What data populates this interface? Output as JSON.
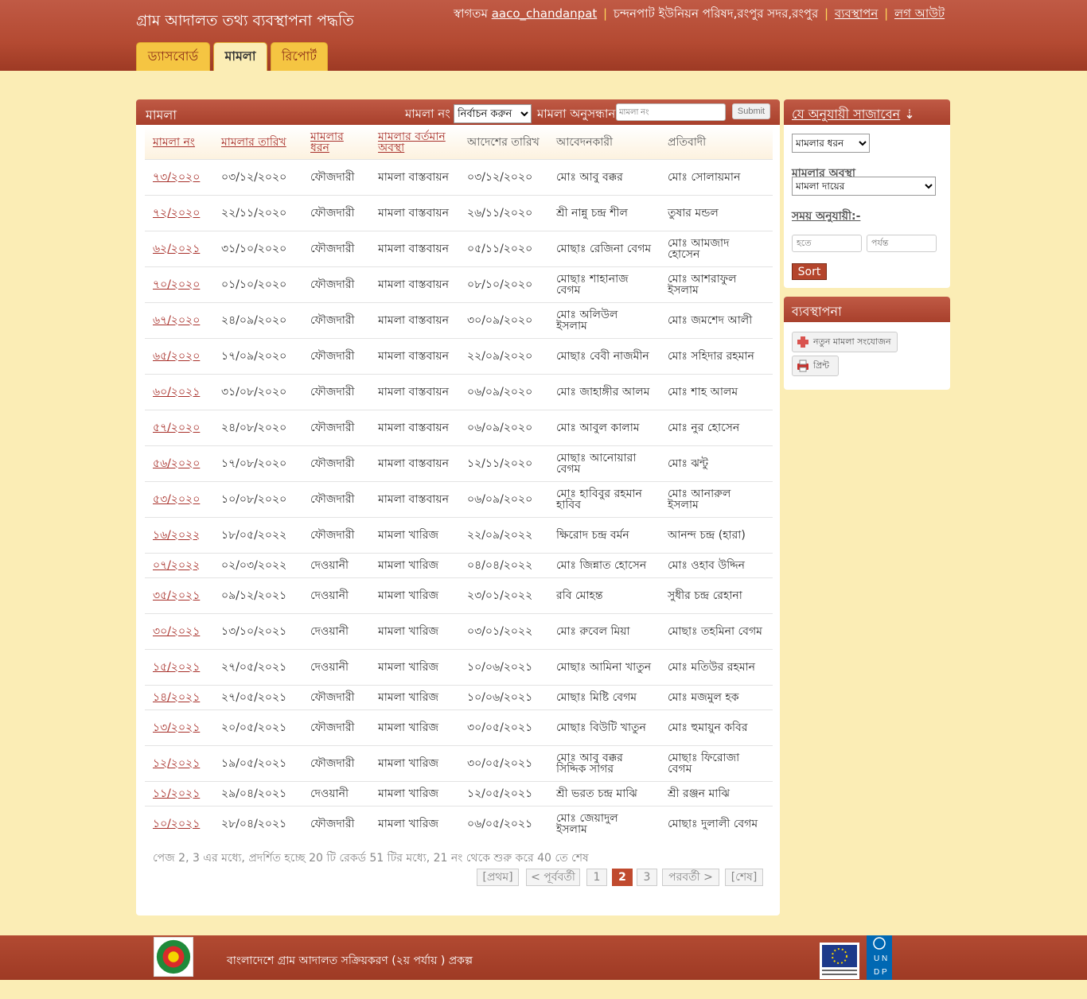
{
  "header": {
    "site_title": "গ্রাম আদালত তথ্য ব্যবস্থাপনা পদ্ধতি",
    "welcome": "স্বাগতম",
    "username": "aaco_chandanpat",
    "union": "চন্দনপাট ইউনিয়ন পরিষদ,রংপুর সদর,রংপুর",
    "manage_link": "ব্যবস্থাপন",
    "logout_link": "লগ আউট",
    "separator": "|"
  },
  "tabs": [
    {
      "label": "ড্যাসবোর্ড"
    },
    {
      "label": "মামলা"
    },
    {
      "label": "রিপোর্ট"
    }
  ],
  "main": {
    "title": "মামলা",
    "case_no_label": "মামলা নং",
    "case_no_select": "নির্বাচন করুন",
    "search_label": "মামলা অনুসন্ধান",
    "search_placeholder": "মামলা নং",
    "submit": "Submit",
    "columns": [
      "মামলা নং",
      "মামলার তারিখ",
      "মামলার ধরন",
      "মামলার বর্তমান অবস্থা",
      "আদেশের তারিখ",
      "আবেদনকারী",
      "প্রতিবাদী"
    ],
    "rows": [
      [
        "৭৩/২০২০",
        "০৩/১২/২০২০",
        "ফৌজদারী",
        "মামলা বাস্তবায়ন",
        "০৩/১২/২০২০",
        "মোঃ আবু বক্কর",
        "মোঃ সোলায়মান"
      ],
      [
        "৭২/২০২০",
        "২২/১১/২০২০",
        "ফৌজদারী",
        "মামলা বাস্তবায়ন",
        "২৬/১১/২০২০",
        "শ্রী নান্নু চন্দ্র শীল",
        "তুষার মন্ডল"
      ],
      [
        "৬২/২০২১",
        "৩১/১০/২০২০",
        "ফৌজদারী",
        "মামলা বাস্তবায়ন",
        "০৫/১১/২০২০",
        "মোছাঃ রেজিনা বেগম",
        "মোঃ আমজাদ হোসেন"
      ],
      [
        "৭০/২০২০",
        "০১/১০/২০২০",
        "ফৌজদারী",
        "মামলা বাস্তবায়ন",
        "০৮/১০/২০২০",
        "মোছাঃ শাহানাজ বেগম",
        "মোঃ আশরাফুল ইসলাম"
      ],
      [
        "৬৭/২০২০",
        "২৪/০৯/২০২০",
        "ফৌজদারী",
        "মামলা বাস্তবায়ন",
        "৩০/০৯/২০২০",
        "মোঃ অলিউল ইসলাম",
        "মোঃ জমশেদ আলী"
      ],
      [
        "৬৫/২০২০",
        "১৭/০৯/২০২০",
        "ফৌজদারী",
        "মামলা বাস্তবায়ন",
        "২২/০৯/২০২০",
        "মোছাঃ বেবী নাজমীন",
        "মোঃ সহিদার রহমান"
      ],
      [
        "৬০/২০২১",
        "৩১/০৮/২০২০",
        "ফৌজদারী",
        "মামলা বাস্তবায়ন",
        "০৬/০৯/২০২০",
        "মোঃ জাহাঙ্গীর আলম",
        "মোঃ শাহ আলম"
      ],
      [
        "৫৭/২০২০",
        "২৪/০৮/২০২০",
        "ফৌজদারী",
        "মামলা বাস্তবায়ন",
        "০৬/০৯/২০২০",
        "মোঃ আবুল কালাম",
        "মোঃ নুর হোসেন"
      ],
      [
        "৫৬/২০২০",
        "১৭/০৮/২০২০",
        "ফৌজদারী",
        "মামলা বাস্তবায়ন",
        "১২/১১/২০২০",
        "মোছাঃ আনোয়ারা বেগম",
        "মোঃ ঝন্টু"
      ],
      [
        "৫৩/২০২০",
        "১০/০৮/২০২০",
        "ফৌজদারী",
        "মামলা বাস্তবায়ন",
        "০৬/০৯/২০২০",
        "মোঃ হাবিবুর রহমান হাবিব",
        "মোঃ আনারুল ইসলাম"
      ],
      [
        "১৬/২০২২",
        "১৮/০৫/২০২২",
        "ফৌজদারী",
        "মামলা খারিজ",
        "২২/০৯/২০২২",
        "ক্ষিরোদ চন্দ্র বর্মন",
        "আনন্দ চন্দ্র (হারা)"
      ],
      [
        "০৭/২০২২",
        "০২/০৩/২০২২",
        "দেওয়ানী",
        "মামলা খারিজ",
        "০৪/০৪/২০২২",
        "মোঃ জিন্নাত হোসেন",
        "মোঃ ওহাব উদ্দিন"
      ],
      [
        "৩৫/২০২১",
        "০৯/১২/২০২১",
        "দেওয়ানী",
        "মামলা খারিজ",
        "২৩/০১/২০২২",
        "রবি মোহন্ত",
        "সুধীর চন্দ্র রেহানা"
      ],
      [
        "৩০/২০২১",
        "১৩/১০/২০২১",
        "দেওয়ানী",
        "মামলা খারিজ",
        "০৩/০১/২০২২",
        "মোঃ রুবেল মিয়া",
        "মোছাঃ তহমিনা বেগম"
      ],
      [
        "১৫/২০২১",
        "২৭/০৫/২০২১",
        "দেওয়ানী",
        "মামলা খারিজ",
        "১০/০৬/২০২১",
        "মোছাঃ আমিনা খাতুন",
        "মোঃ মতিউর রহমান"
      ],
      [
        "১৪/২০২১",
        "২৭/০৫/২০২১",
        "ফৌজদারী",
        "মামলা খারিজ",
        "১০/০৬/২০২১",
        "মোছাঃ মিষ্টি বেগম",
        "মোঃ মজমুল হক"
      ],
      [
        "১৩/২০২১",
        "২০/০৫/২০২১",
        "ফৌজদারী",
        "মামলা খারিজ",
        "৩০/০৫/২০২১",
        "মোছাঃ বিউটি খাতুন",
        "মোঃ হুমায়ুন কবির"
      ],
      [
        "১২/২০২১",
        "১৯/০৫/২০২১",
        "ফৌজদারী",
        "মামলা খারিজ",
        "৩০/০৫/২০২১",
        "মোঃ আবু বক্কর সিদ্দিক সাগর",
        "মোছাঃ ফিরোজা বেগম"
      ],
      [
        "১১/২০২১",
        "২৯/০৪/২০২১",
        "দেওয়ানী",
        "মামলা খারিজ",
        "১২/০৫/২০২১",
        "শ্রী ভরত চন্দ্র মাঝি",
        "শ্রী রঞ্জন মাঝি"
      ],
      [
        "১০/২০২১",
        "২৮/০৪/২০২১",
        "ফৌজদারী",
        "মামলা খারিজ",
        "০৬/০৫/২০২১",
        "মোঃ জেয়াদুল ইসলাম",
        "মোছাঃ দুলালী বেগম"
      ]
    ],
    "summary": "পেজ 2, 3 এর মধ্যে, প্রদর্শিত হচ্ছে 20 টি রেকর্ড 51 টির মধ্যে, 21 নং থেকে শুরু করে 40 তে শেষ",
    "pager": {
      "first": "[প্রথম]",
      "prev": "< পূর্ববর্তী",
      "p1": "1",
      "p2": "2",
      "p3": "3",
      "next": "পরবর্তী >",
      "last": "[শেষ]"
    }
  },
  "sidebar": {
    "sort_title": "যে অনুযায়ী সাজাবেন",
    "sort_arrow": "⇣",
    "case_type_select": "মামলার ধরন",
    "status_label": "মামলার অবস্থা",
    "status_select": "মামলা দায়ের",
    "time_label": "সময় অনুযায়ী:-",
    "from_placeholder": "হতে",
    "to_placeholder": "পর্যন্ত",
    "sort_button": "Sort",
    "manage_title": "ব্যবস্থাপনা",
    "new_case_button": "নতুন মামলা সংযোজন",
    "print_button": "প্রিন্ট"
  },
  "footer": {
    "project_text": "বাংলাদেশে গ্রাম আদালত সক্রিয়করণ (২য় পর্যায় ) প্রকল্প",
    "undp_text": "UNDP"
  },
  "colors": {
    "brand": "#b44a32",
    "background": "#fbedb5",
    "tab": "#f5c542",
    "link": "#a8302a"
  }
}
